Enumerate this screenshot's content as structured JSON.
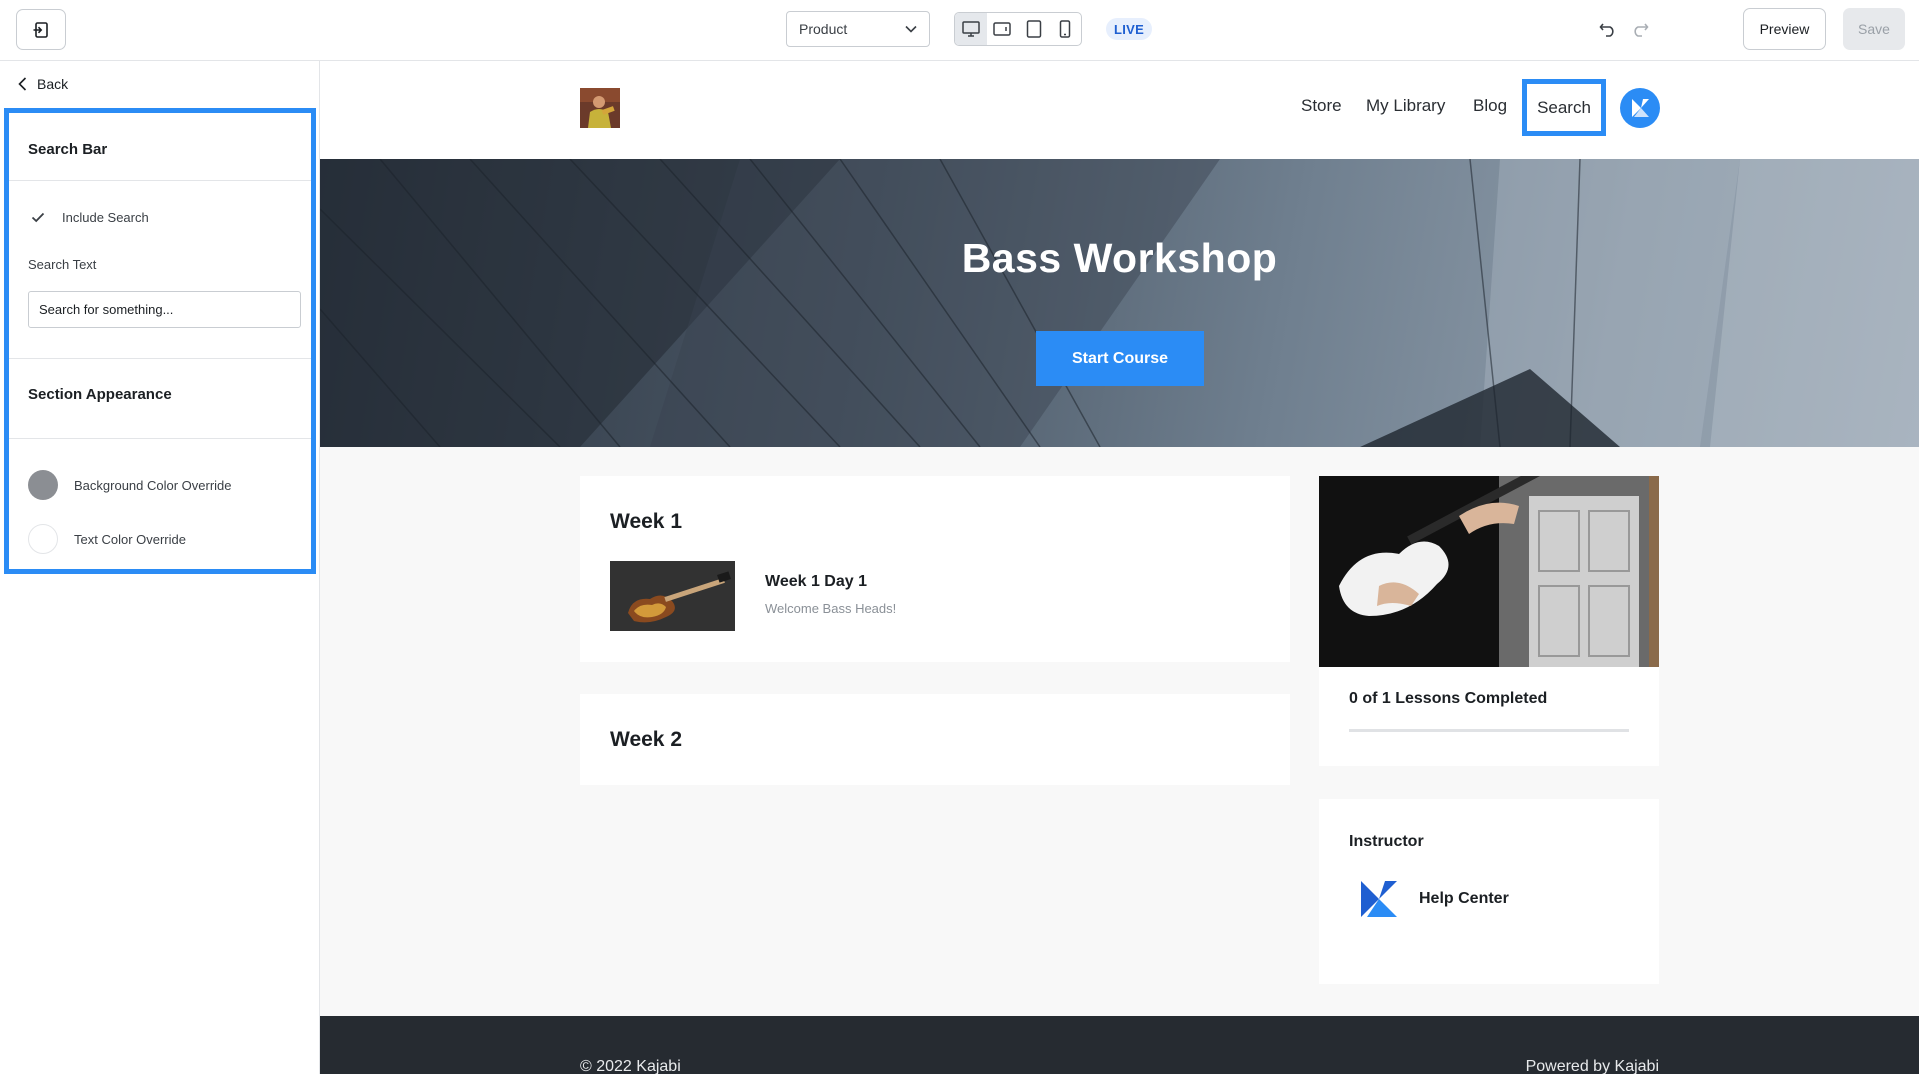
{
  "topbar": {
    "page_select": {
      "value": "Product"
    },
    "devices": [
      "desktop-icon",
      "tablet-landscape-icon",
      "tablet-icon",
      "mobile-icon"
    ],
    "live_badge": "LIVE",
    "preview_label": "Preview",
    "save_label": "Save"
  },
  "sidebar": {
    "back_label": "Back",
    "search_bar": {
      "title": "Search Bar",
      "include_search_label": "Include Search",
      "include_search_checked": true,
      "search_text_label": "Search Text",
      "search_text_value": "Search for something..."
    },
    "appearance": {
      "title": "Section Appearance",
      "bg_override_label": "Background Color Override",
      "bg_override_color": "#8b8e93",
      "text_override_label": "Text Color Override",
      "text_override_color": "#ffffff"
    }
  },
  "site": {
    "nav": [
      "Store",
      "My Library",
      "Blog",
      "Search"
    ],
    "hero_title": "Bass Workshop",
    "hero_button": "Start Course",
    "weeks": [
      {
        "title": "Week 1",
        "lessons": [
          {
            "title": "Week 1 Day 1",
            "subtitle": "Welcome Bass Heads!"
          }
        ]
      },
      {
        "title": "Week 2",
        "lessons": []
      }
    ],
    "progress": {
      "label": "0 of 1 Lessons Completed",
      "fraction": 0
    },
    "instructor": {
      "label": "Instructor",
      "name": "Help Center"
    },
    "footer_left": "© 2022 Kajabi",
    "footer_right": "Powered by Kajabi"
  },
  "colors": {
    "accent": "#2b8cf5",
    "footer": "#262b31",
    "live_badge_text": "#1f5fd1"
  }
}
